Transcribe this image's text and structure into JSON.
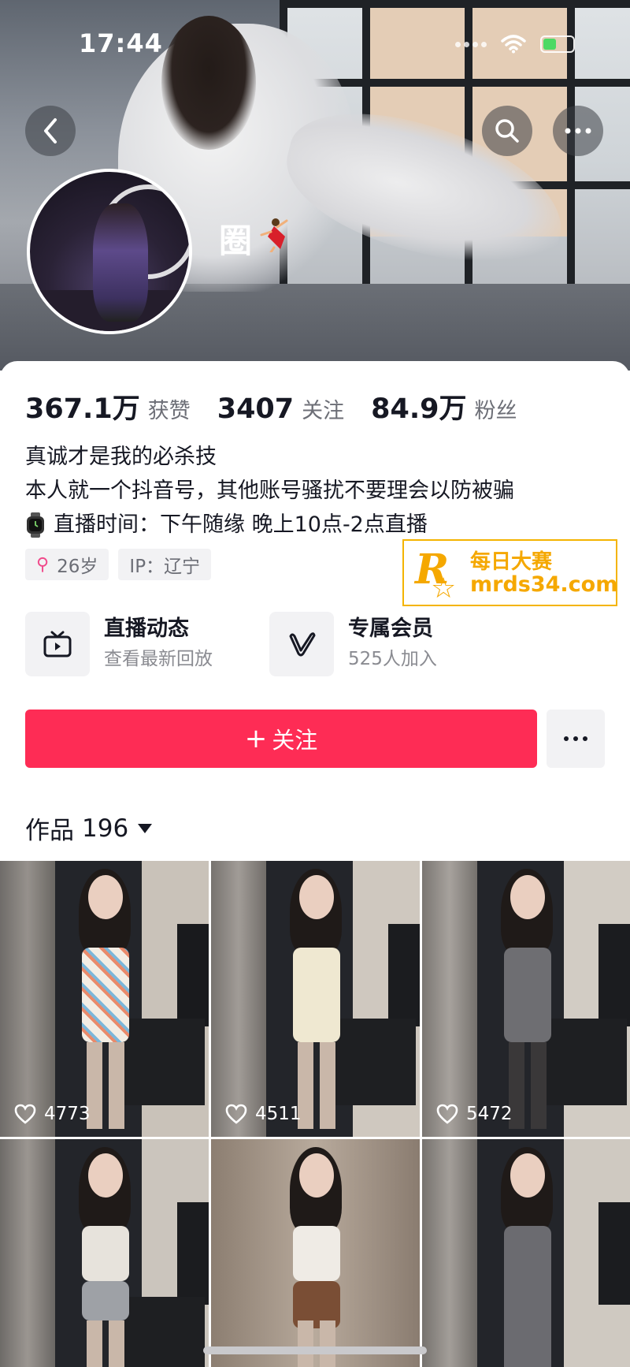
{
  "status_bar": {
    "time": "17:44"
  },
  "profile": {
    "nickname": "圈",
    "stats": [
      {
        "value": "367.1万",
        "label": "获赞"
      },
      {
        "value": "3407",
        "label": "关注"
      },
      {
        "value": "84.9万",
        "label": "粉丝"
      }
    ],
    "bio": [
      "真诚才是我的必杀技",
      "本人就一个抖音号，其他账号骚扰不要理会以防被骗",
      "直播时间：下午随缘 晚上10点-2点直播"
    ],
    "tags": [
      {
        "icon": "female-symbol",
        "text": "26岁"
      },
      {
        "text": "IP：辽宁"
      }
    ]
  },
  "watermark": {
    "cn": "每日大赛",
    "url": "mrds34.com",
    "letter": "R"
  },
  "features": [
    {
      "icon": "tv-icon",
      "title": "直播动态",
      "subtitle": "查看最新回放"
    },
    {
      "icon": "v-member-icon",
      "title": "专属会员",
      "subtitle": "525人加入"
    }
  ],
  "actions": {
    "follow_label": "关注",
    "follow_plus": "+"
  },
  "works": {
    "label": "作品",
    "count": "196",
    "items": [
      {
        "likes": "4773"
      },
      {
        "likes": "4511"
      },
      {
        "likes": "5472"
      },
      {
        "likes": ""
      },
      {
        "likes": ""
      },
      {
        "likes": ""
      }
    ]
  },
  "colors": {
    "accent": "#fe2c55",
    "watermark": "#f5a800",
    "tag_bg": "#f2f2f4"
  }
}
